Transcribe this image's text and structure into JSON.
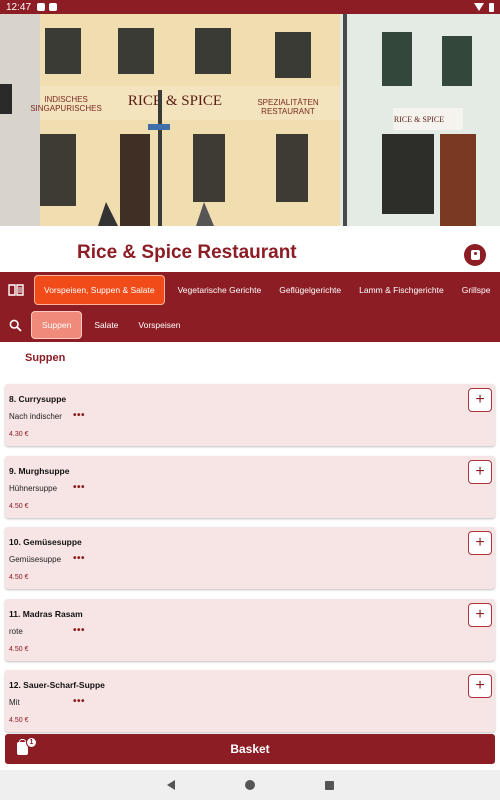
{
  "status_bar": {
    "time": "12:47"
  },
  "hero": {
    "sign_left": "INDISCHES\nSINGAPURISCHES",
    "sign_logo": "RICE & SPICE",
    "sign_right": "SPEZIALITÄTEN\nRESTAURANT",
    "sign_small": "RICE & SPICE"
  },
  "header": {
    "title": "Rice & Spice Restaurant",
    "profile_icon": "profile-icon"
  },
  "categories": [
    {
      "label": "Vorspeisen, Suppen & Salate",
      "active": true
    },
    {
      "label": "Vegetarische Gerichte",
      "active": false
    },
    {
      "label": "Geflügelgerichte",
      "active": false
    },
    {
      "label": "Lamm & Fischgerichte",
      "active": false
    },
    {
      "label": "Grillspe",
      "active": false
    }
  ],
  "subcategories": [
    {
      "label": "Suppen",
      "active": true
    },
    {
      "label": "Salate",
      "active": false
    },
    {
      "label": "Vorspeisen",
      "active": false
    }
  ],
  "section": {
    "title": "Suppen"
  },
  "items": [
    {
      "name": "8. Currysuppe",
      "description": "Nach indischer",
      "more": "•••",
      "price": "4.30 €",
      "add": "+"
    },
    {
      "name": "9. Murghsuppe",
      "description": "Hühnersuppe",
      "more": "•••",
      "price": "4.50 €",
      "add": "+"
    },
    {
      "name": "10. Gemüsesuppe",
      "description": "Gemüsesuppe",
      "more": "•••",
      "price": "4.50 €",
      "add": "+"
    },
    {
      "name": "11. Madras Rasam",
      "description": "rote",
      "more": "•••",
      "price": "4.50 €",
      "add": "+"
    },
    {
      "name": "12. Sauer-Scharf-Suppe",
      "description": "Mit",
      "more": "•••",
      "price": "4.50 €",
      "add": "+"
    }
  ],
  "basket": {
    "label": "Basket",
    "count": "1"
  },
  "colors": {
    "brand": "#8c1d24",
    "active_category": "#f14b1a",
    "active_sub": "#f08a7a",
    "card_bg": "#f7e4e4"
  }
}
